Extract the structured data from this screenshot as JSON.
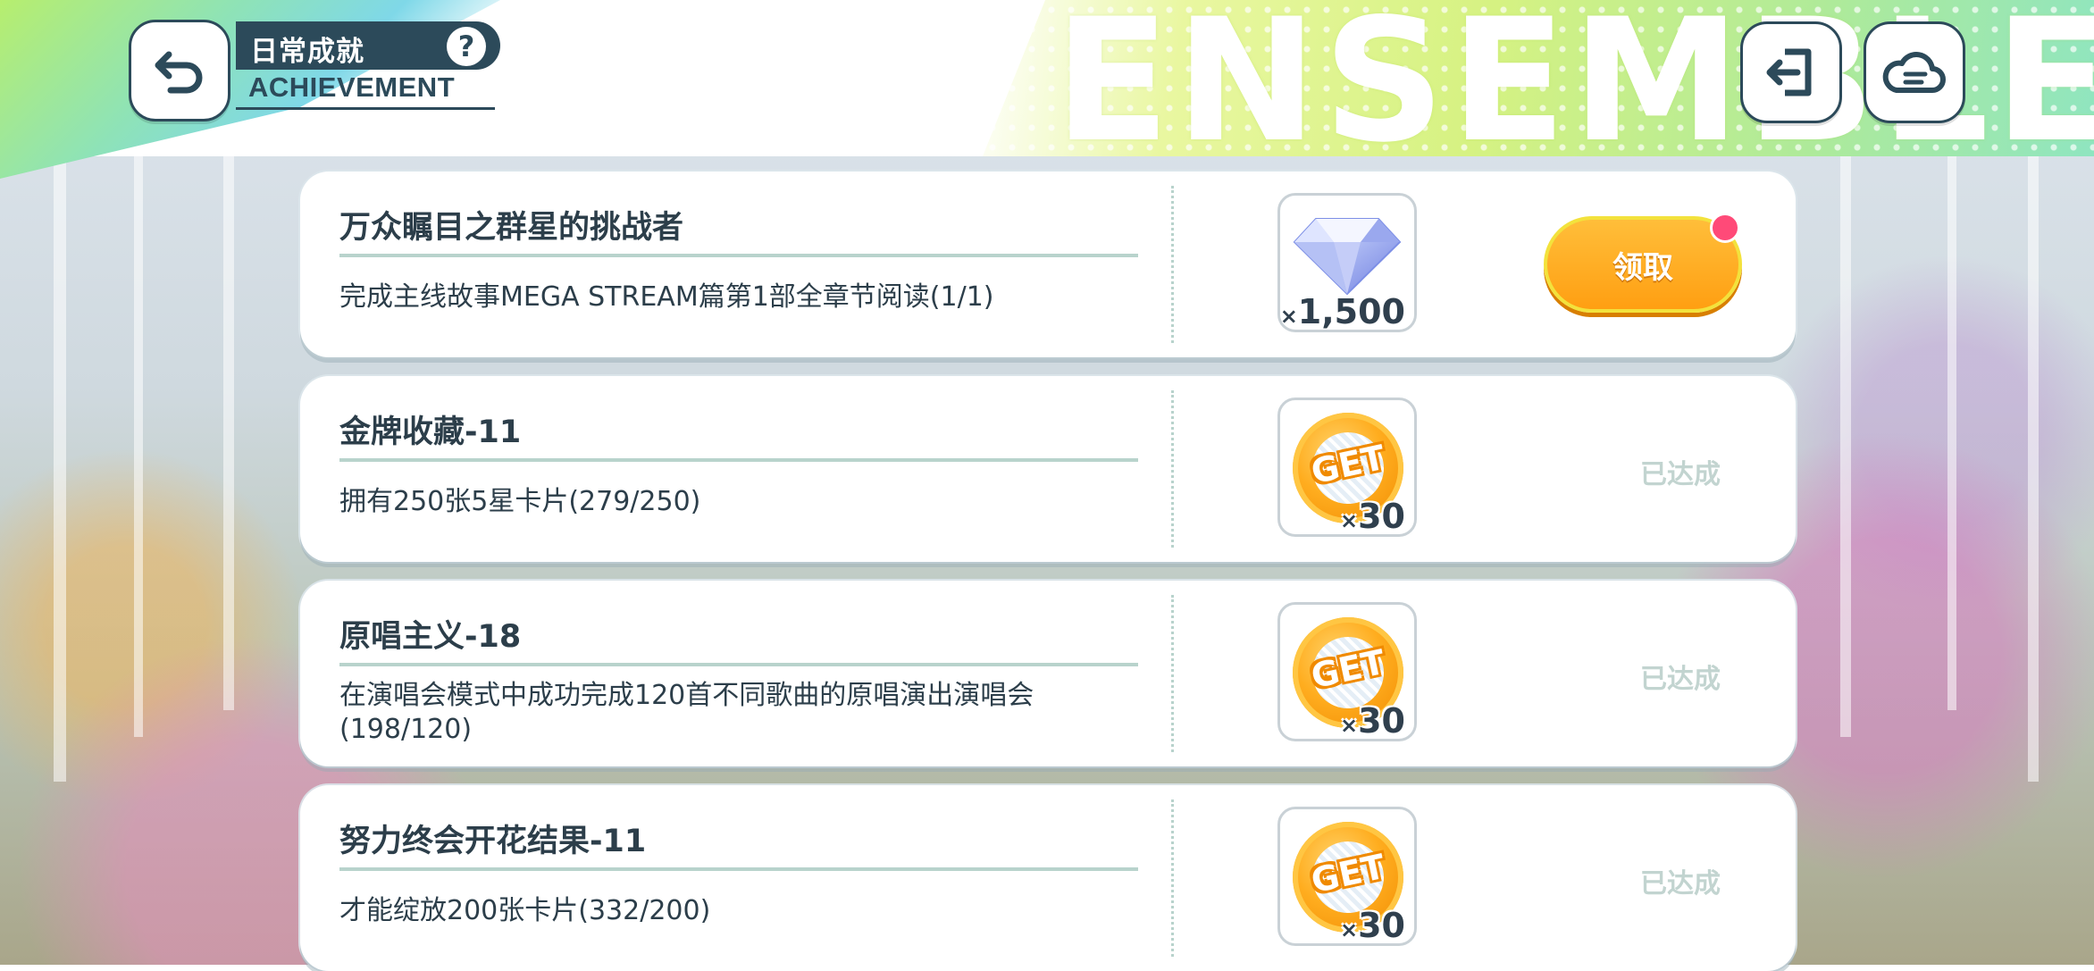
{
  "header": {
    "back_icon": "back-arrow-icon",
    "title_cn": "日常成就",
    "title_en": "ACHIEVEMENT",
    "help_label": "?",
    "logout_icon": "exit-icon",
    "cloud_icon": "cloud-menu-icon",
    "banner_text": "ENSEMBLE"
  },
  "colors": {
    "navy": "#2c4a5a",
    "claim_orange": "#ff9f12",
    "achieved_text": "#c2d4d0",
    "rule": "#b8d3cc",
    "notify": "#ff4a78"
  },
  "achievements": [
    {
      "title": "万众瞩目之群星的挑战者",
      "description": "完成主线故事MEGA STREAM篇第1部全章节阅读(1/1)",
      "reward_icon": "diamond-icon",
      "reward_qty_prefix": "×",
      "reward_qty": "1,500",
      "action": "领取",
      "state": "claimable"
    },
    {
      "title": "金牌收藏-11",
      "description": "拥有250张5星卡片(279/250)",
      "reward_icon": "get-coin-icon",
      "reward_text": "GET",
      "reward_qty_prefix": "×",
      "reward_qty": "30",
      "action": "已达成",
      "state": "achieved"
    },
    {
      "title": "原唱主义-18",
      "description": "在演唱会模式中成功完成120首不同歌曲的原唱演出演唱会(198/120)",
      "reward_icon": "get-coin-icon",
      "reward_text": "GET",
      "reward_qty_prefix": "×",
      "reward_qty": "30",
      "action": "已达成",
      "state": "achieved"
    },
    {
      "title": "努力终会开花结果-11",
      "description": "才能绽放200张卡片(332/200)",
      "reward_icon": "get-coin-icon",
      "reward_text": "GET",
      "reward_qty_prefix": "×",
      "reward_qty": "30",
      "action": "已达成",
      "state": "achieved"
    }
  ]
}
